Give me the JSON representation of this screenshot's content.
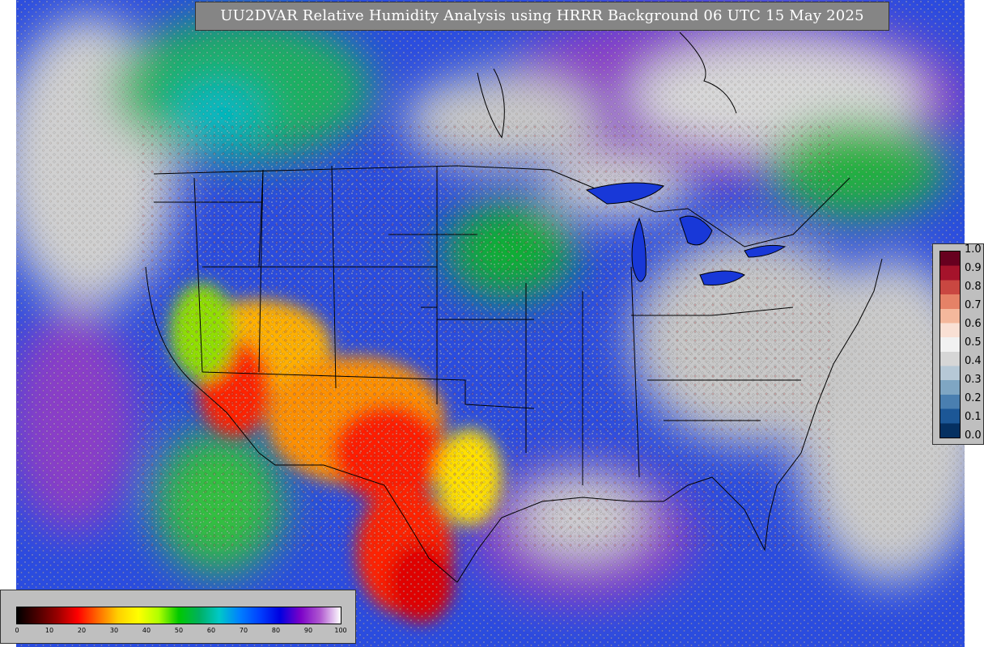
{
  "title": "UU2DVAR Relative Humidity Analysis using HRRR Background 06 UTC 15 May 2025",
  "rh_legend": {
    "ticks": [
      "1.0",
      "0.9",
      "0.8",
      "0.7",
      "0.6",
      "0.5",
      "0.4",
      "0.3",
      "0.2",
      "0.1",
      "0.0"
    ],
    "colors": [
      "#67001f",
      "#a5132b",
      "#c94741",
      "#e58267",
      "#f4b89c",
      "#f9e0d4",
      "#f1f1f1",
      "#d6d6d6",
      "#b6c8d6",
      "#7fa6c3",
      "#4a7fb0",
      "#1c5796",
      "#053061"
    ]
  },
  "percent_legend": {
    "ticks": [
      "0",
      "10",
      "20",
      "30",
      "40",
      "50",
      "60",
      "70",
      "80",
      "90",
      "100"
    ],
    "colors": [
      "#000000",
      "#4a0000",
      "#990000",
      "#ff0000",
      "#ff6a00",
      "#ffd000",
      "#ffff00",
      "#b0ff00",
      "#00c800",
      "#00b060",
      "#00c8c8",
      "#0080ff",
      "#0040ff",
      "#0000e0",
      "#7a00c8",
      "#b05ad0",
      "#ffffff"
    ]
  }
}
